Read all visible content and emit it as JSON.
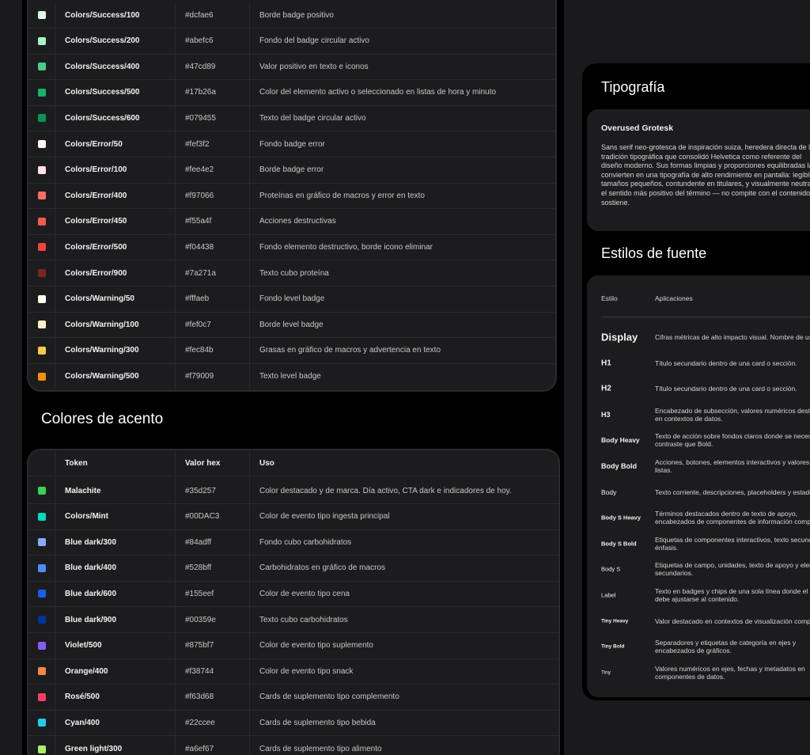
{
  "semantic_rows": [
    {
      "token": "Colors/Success/100",
      "hex": "#dcfae6",
      "use": "Borde badge positivo",
      "color": "#dcfae6"
    },
    {
      "token": "Colors/Success/200",
      "hex": "#abefc6",
      "use": "Fondo del badge circular activo",
      "color": "#abefc6"
    },
    {
      "token": "Colors/Success/400",
      "hex": "#47cd89",
      "use": "Valor positivo en texto e iconos",
      "color": "#47cd89"
    },
    {
      "token": "Colors/Success/500",
      "hex": "#17b26a",
      "use": "Color del elemento activo o seleccionado en listas de hora y minuto",
      "color": "#17b26a"
    },
    {
      "token": "Colors/Success/600",
      "hex": "#079455",
      "use": "Texto del badge circular activo",
      "color": "#079455"
    },
    {
      "token": "Colors/Error/50",
      "hex": "#fef3f2",
      "use": "Fondo badge error",
      "color": "#fef3f2"
    },
    {
      "token": "Colors/Error/100",
      "hex": "#fee4e2",
      "use": "Borde badge error",
      "color": "#fee4e2"
    },
    {
      "token": "Colors/Error/400",
      "hex": "#f97066",
      "use": "Proteínas en gráfico de macros y error en texto",
      "color": "#f97066"
    },
    {
      "token": "Colors/Error/450",
      "hex": "#f55a4f",
      "use": "Acciones destructivas",
      "color": "#f55a4f"
    },
    {
      "token": "Colors/Error/500",
      "hex": "#f04438",
      "use": "Fondo elemento destructivo, borde icono eliminar",
      "color": "#f04438"
    },
    {
      "token": "Colors/Error/900",
      "hex": "#7a271a",
      "use": "Texto cubo proteína",
      "color": "#7a271a"
    },
    {
      "token": "Colors/Warning/50",
      "hex": "#fffaeb",
      "use": "Fondo level badge",
      "color": "#fffaeb"
    },
    {
      "token": "Colors/Warning/100",
      "hex": "#fef0c7",
      "use": "Borde level badge",
      "color": "#fef0c7"
    },
    {
      "token": "Colors/Warning/300",
      "hex": "#fec84b",
      "use": "Grasas en gráfico de macros y advertencia en texto",
      "color": "#fec84b"
    },
    {
      "token": "Colors/Warning/500",
      "hex": "#f79009",
      "use": "Texto level badge",
      "color": "#f79009"
    }
  ],
  "accent_section": {
    "title": "Colores de acento",
    "headers": {
      "token": "Token",
      "hex": "Valor hex",
      "use": "Uso"
    },
    "rows": [
      {
        "token": "Malachite",
        "hex": "#35d257",
        "use": "Color destacado y de marca. Día activo, CTA dark e indicadores de hoy.",
        "color": "#35d257"
      },
      {
        "token": "Colors/Mint",
        "hex": "#00DAC3",
        "use": "Color de evento tipo ingesta principal",
        "color": "#00dac3"
      },
      {
        "token": "Blue dark/300",
        "hex": "#84adff",
        "use": "Fondo cubo carbohidratos",
        "color": "#84adff"
      },
      {
        "token": "Blue dark/400",
        "hex": "#528bff",
        "use": "Carbohidratos en gráfico de macros",
        "color": "#528bff"
      },
      {
        "token": "Blue dark/600",
        "hex": "#155eef",
        "use": "Color de evento tipo cena",
        "color": "#155eef"
      },
      {
        "token": "Blue dark/900",
        "hex": "#00359e",
        "use": "Texto cubo carbohidratos",
        "color": "#00359e"
      },
      {
        "token": "Violet/500",
        "hex": "#875bf7",
        "use": "Color de evento tipo suplemento",
        "color": "#875bf7"
      },
      {
        "token": "Orange/400",
        "hex": "#f38744",
        "use": "Color de evento tipo snack",
        "color": "#f38744"
      },
      {
        "token": "Rosé/500",
        "hex": "#f63d68",
        "use": "Cards de suplemento tipo complemento",
        "color": "#f63d68"
      },
      {
        "token": "Cyan/400",
        "hex": "#22ccee",
        "use": "Cards de suplemento tipo bebida",
        "color": "#22ccee"
      },
      {
        "token": "Green light/300",
        "hex": "#a6ef67",
        "use": "Cards de suplemento tipo alimento",
        "color": "#a6ef67"
      }
    ]
  },
  "typography": {
    "title": "Tipografía",
    "font_name": "Overused Grotesk",
    "font_description": "Sans serif neo-grotesca de inspiración suiza, heredera directa de la tradición tipográfica que consolidó Helvetica como referente del diseño moderno. Sus formas limpias y proporciones equilibradas la convierten en una tipografía de alto rendimiento en pantalla: legible a tamaños pequeños, contundente en titulares, y visualmente neutra en el sentido más positivo del término — no compite con el contenido, lo sostiene.",
    "styles_title": "Estilos de fuente",
    "styles_headers": {
      "style": "Estilo",
      "applications": "Aplicaciones"
    },
    "styles": [
      {
        "name": "Display",
        "app": "Cifras métricas de alto impacto visual. Nombre de usuario."
      },
      {
        "name": "H1",
        "app": "Título secundario dentro de una card o sección."
      },
      {
        "name": "H2",
        "app": "Título secundario dentro de una card o sección."
      },
      {
        "name": "H3",
        "app": "Encabezado de subsección, valores numéricos destacados en contextos de datos."
      },
      {
        "name": "Body Heavy",
        "app": "Texto de acción sobre fondos claros donde se necesita más contraste que Bold."
      },
      {
        "name": "Body Bold",
        "app": "Acciones, botones, elementos interactivos y valores clave en listas."
      },
      {
        "name": "Body",
        "app": "Texto corriente, descripciones, placeholders y estados."
      },
      {
        "name": "Body S Heavy",
        "app": "Términos destacados dentro de texto de apoyo, encabezados de componentes de información compacta."
      },
      {
        "name": "Body S Bold",
        "app": "Etiquetas de componentes interactivos, texto secundario con énfasis."
      },
      {
        "name": "Body S",
        "app": "Etiquetas de campo, unidades, texto de apoyo y elementos secundarios."
      },
      {
        "name": "Label",
        "app": "Texto en badges y chips de una sola línea donde el ancho debe ajustarse al contenido."
      },
      {
        "name": "Tiny Heavy",
        "app": "Valor destacado en contextos de visualización compacta."
      },
      {
        "name": "Tiny Bold",
        "app": "Separadores y etiquetas de categoría en ejes y encabezados de gráficos."
      },
      {
        "name": "Tiny",
        "app": "Valores numéricos en ejes, fechas y metadatos en componentes de datos."
      }
    ]
  }
}
